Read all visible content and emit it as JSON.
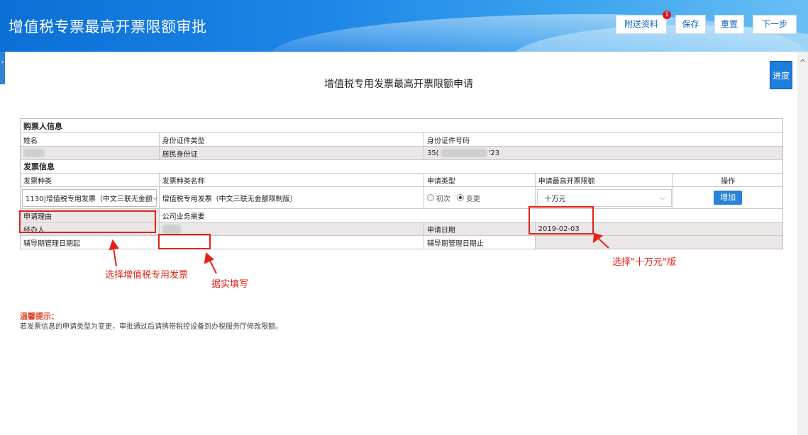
{
  "header": {
    "title": "增值税专票最高开票限额审批",
    "buttons": [
      "附送资料",
      "保存",
      "重置",
      "下一步"
    ],
    "badge_count": "1"
  },
  "progress_label": "进度",
  "page_title": "增值税专用发票最高开票限额申请",
  "buyer_section": {
    "label": "购票人信息",
    "headers": [
      "姓名",
      "身份证件类型",
      "身份证件号码"
    ],
    "values": {
      "id_type": "居民身份证",
      "id_prefix": "35(",
      "id_suffix": "'23"
    }
  },
  "invoice_section": {
    "label": "发票信息",
    "headers": [
      "发票种类",
      "发票种类名称",
      "申请类型",
      "申请最高开票限额",
      "操作"
    ],
    "invoice_type": "1130|增值税专用发票（中文三联无金额",
    "invoice_name": "增值税专用发票（中文三联无金额限制版）",
    "apply_types": [
      {
        "label": "初次",
        "checked": false
      },
      {
        "label": "变更",
        "checked": true
      }
    ],
    "limit": "十万元",
    "add_label": "增加",
    "reason_label": "申请理由",
    "reason_value": "公司业务需要",
    "agent_label": "经办人",
    "apply_date_label": "申请日期",
    "apply_date": "2019-02-03",
    "period_start_label": "辅导期管理日期起",
    "period_end_label": "辅导期管理日期止"
  },
  "annotations": {
    "select_type": "选择增值税专用发票",
    "fill_truth": "据实填写",
    "select_limit": "选择\"十万元\"版"
  },
  "tips": {
    "title": "温馨提示：",
    "text": "若发票信息的申请类型为变更，审批通过后请携带税控设备到办税服务厅修改限额。"
  },
  "colors": {
    "header": "#1d86e6",
    "accent": "#2a82d9",
    "annotation": "#e2231a"
  }
}
